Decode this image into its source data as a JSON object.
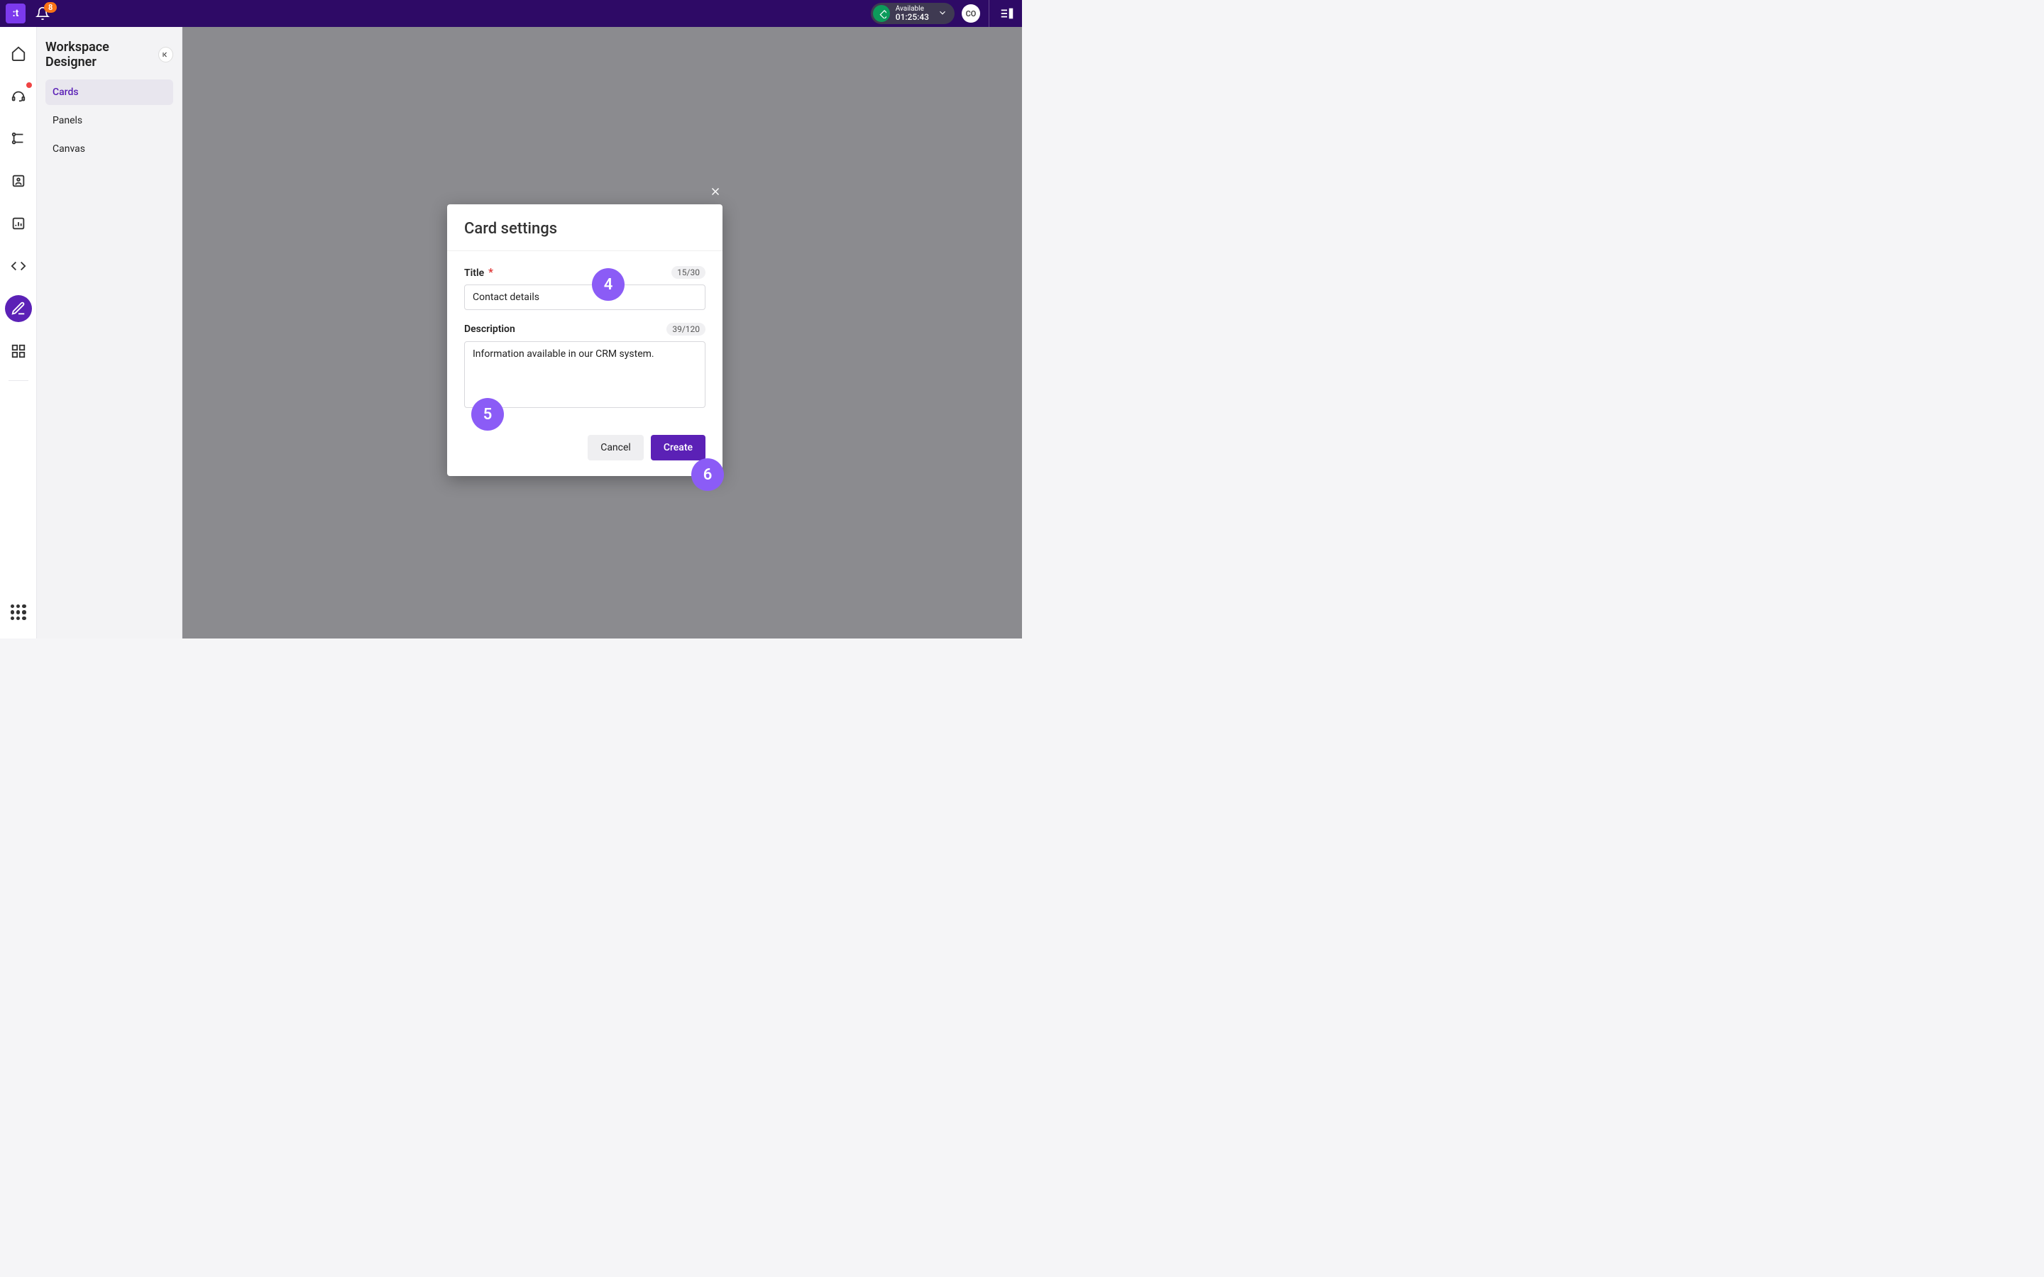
{
  "topbar": {
    "logo_text": ":t",
    "notification_count": "8",
    "status": {
      "label": "Available",
      "timer": "01:25:43"
    },
    "avatar_initials": "CO"
  },
  "sidebar": {
    "title": "Workspace Designer",
    "items": [
      {
        "label": "Cards",
        "active": true
      },
      {
        "label": "Panels",
        "active": false
      },
      {
        "label": "Canvas",
        "active": false
      }
    ]
  },
  "modal": {
    "title": "Card settings",
    "title_field": {
      "label": "Title",
      "required_mark": "*",
      "value": "Contact details",
      "counter": "15/30"
    },
    "description_field": {
      "label": "Description",
      "value": "Information available in our CRM system.",
      "counter": "39/120"
    },
    "cancel_label": "Cancel",
    "create_label": "Create"
  },
  "markers": {
    "m4": "4",
    "m5": "5",
    "m6": "6"
  }
}
